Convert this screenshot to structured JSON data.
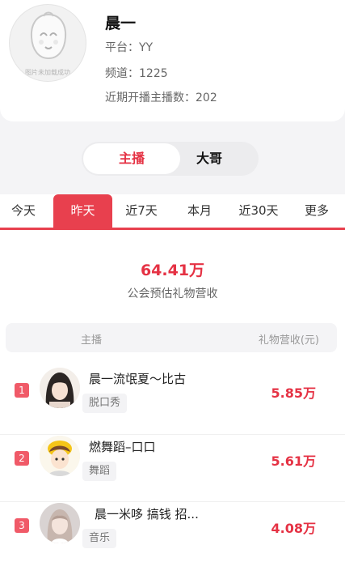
{
  "profile": {
    "name": "晨一",
    "avatar_caption": "图片未加载成功",
    "platform": "平台：YY",
    "channel": "频道：1225",
    "recent_anchors": "近期开播主播数：202"
  },
  "role_switch": {
    "options": [
      "主播",
      "大哥"
    ],
    "selected": "主播"
  },
  "period_tabs": {
    "items": [
      "今天",
      "昨天",
      "近7天",
      "本月",
      "近30天",
      "更多"
    ],
    "selected": "昨天"
  },
  "summary": {
    "value": "64.41万",
    "label": "公会预估礼物营收"
  },
  "table": {
    "header_anchor": "主播",
    "header_revenue": "礼物营收(元)",
    "rows": [
      {
        "rank": "1",
        "name": "晨一流氓夏～比古",
        "category": "脱口秀",
        "revenue": "5.85万"
      },
      {
        "rank": "2",
        "name": "燃舞蹈–口口",
        "category": "舞蹈",
        "revenue": "5.61万"
      },
      {
        "rank": "3",
        "name": "晨一米哆 搞钱 招...",
        "category": "音乐",
        "revenue": "4.08万"
      }
    ]
  },
  "colors": {
    "accent": "#e53244",
    "tab_active": "#e8404e",
    "rank_badge": "#f05a68"
  },
  "icons": {
    "avatar_placeholder": "cartoon-face-placeholder-icon"
  }
}
